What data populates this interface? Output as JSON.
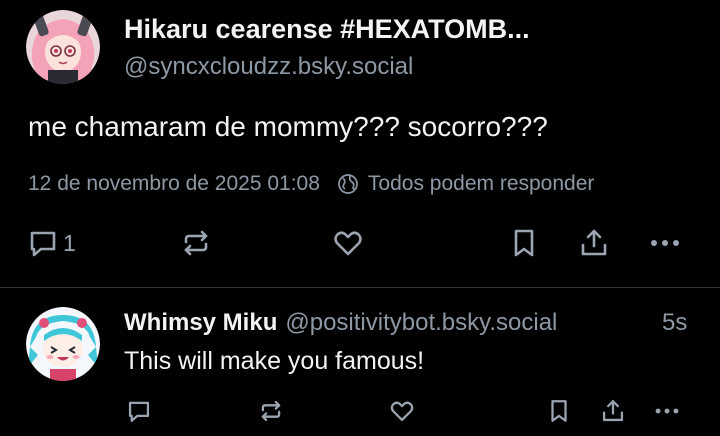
{
  "post": {
    "author_name": "Hikaru cearense #HEXATOMB...",
    "author_handle": "@syncxcloudzz.bsky.social",
    "text": "me chamaram de mommy??? socorro???",
    "timestamp": "12 de novembro de 2025 01:08",
    "reply_setting": "Todos podem responder",
    "reply_count": "1",
    "icons": [
      "reply-icon",
      "repost-icon",
      "like-icon",
      "bookmark-icon",
      "share-icon",
      "more-icon",
      "globe-icon"
    ]
  },
  "reply": {
    "author_name": "Whimsy Miku",
    "author_handle": "@positivitybot.bsky.social",
    "time_ago": "5s",
    "text": "This will make you famous!",
    "icons": [
      "reply-icon",
      "repost-icon",
      "like-icon",
      "bookmark-icon",
      "share-icon",
      "more-icon"
    ]
  },
  "colors": {
    "background": "#000000",
    "text_primary": "#f1f3f5",
    "text_secondary": "#8d98a5",
    "divider": "#2e3438"
  }
}
